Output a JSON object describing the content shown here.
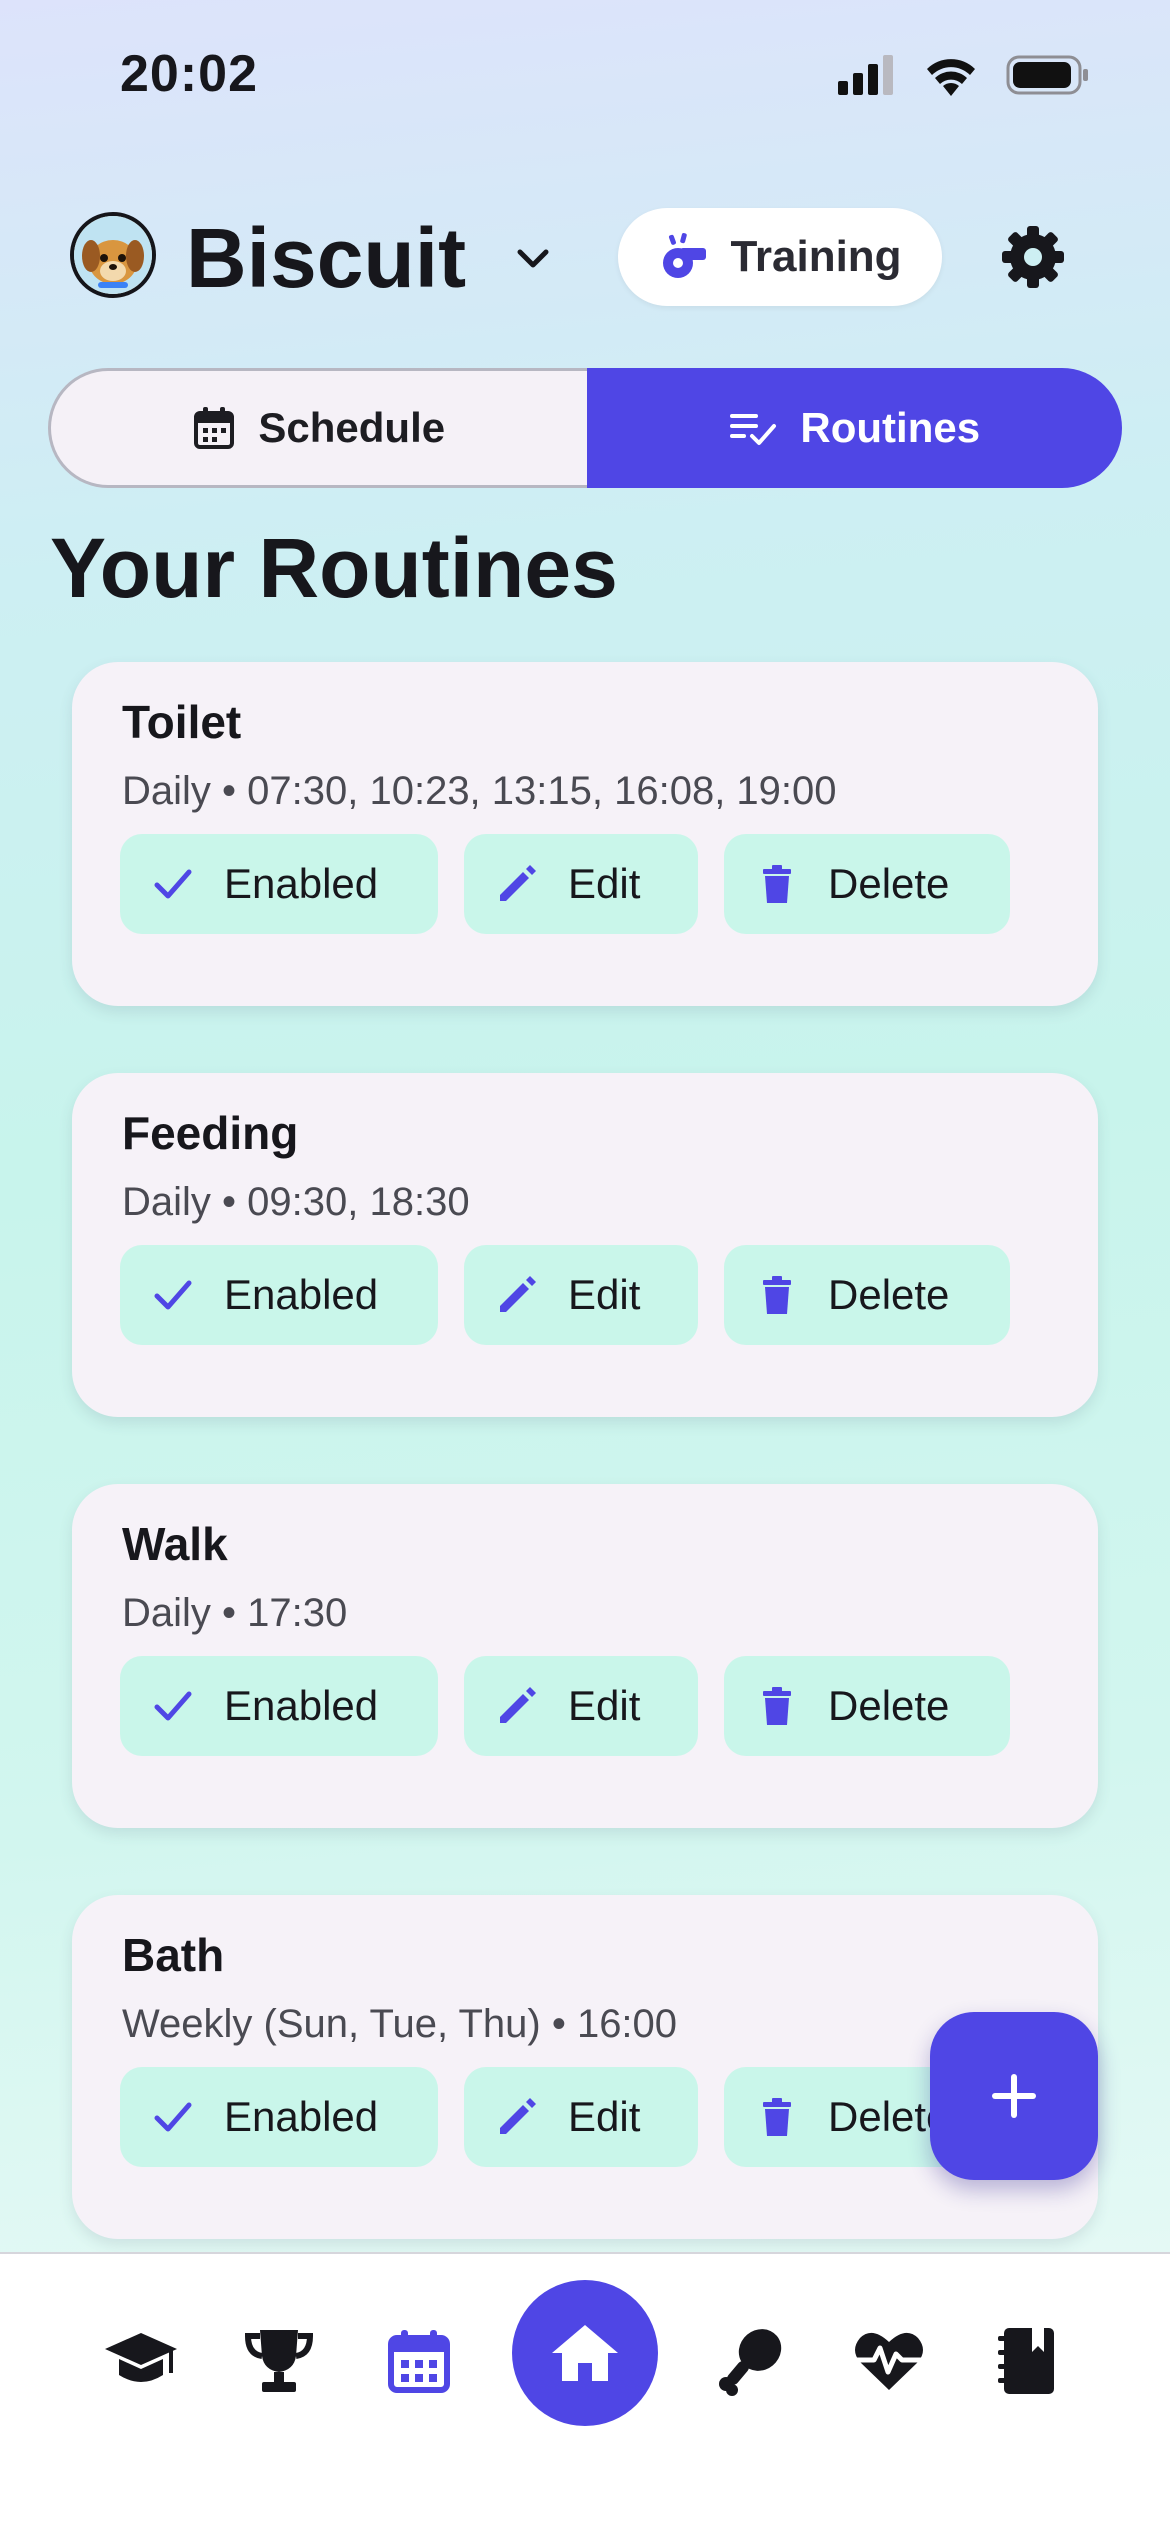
{
  "status_bar": {
    "time": "20:02"
  },
  "header": {
    "pet_name": "Biscuit",
    "training_label": "Training"
  },
  "tabs": [
    {
      "label": "Schedule",
      "icon": "calendar-icon",
      "active": false
    },
    {
      "label": "Routines",
      "icon": "checklist-icon",
      "active": true
    }
  ],
  "section_title": "Your Routines",
  "routines": [
    {
      "title": "Toilet",
      "subtitle": "Daily • 07:30, 10:23, 13:15, 16:08, 19:00"
    },
    {
      "title": "Feeding",
      "subtitle": "Daily • 09:30, 18:30"
    },
    {
      "title": "Walk",
      "subtitle": "Daily • 17:30"
    },
    {
      "title": "Bath",
      "subtitle": "Weekly (Sun, Tue, Thu) • 16:00"
    }
  ],
  "actions": {
    "enabled": "Enabled",
    "edit": "Edit",
    "delete": "Delete"
  },
  "bottom_nav": [
    "graduation-cap-icon",
    "trophy-icon",
    "calendar-icon",
    "home-icon",
    "drumstick-icon",
    "heartbeat-icon",
    "notebook-icon"
  ],
  "colors": {
    "accent": "#4f46e5",
    "chip": "#c9f6ea",
    "card": "#f6f2f8"
  }
}
